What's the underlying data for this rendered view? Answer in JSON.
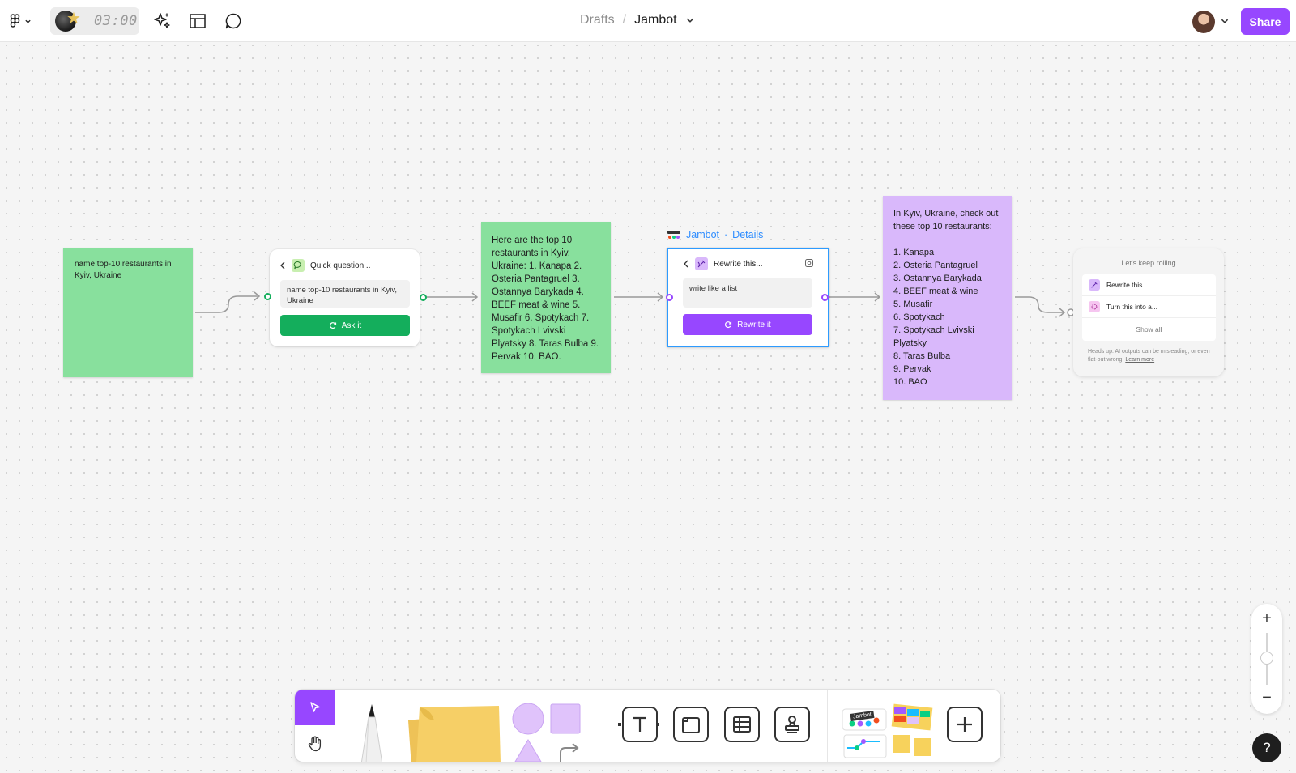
{
  "header": {
    "timer": "03:00",
    "breadcrumb_parent": "Drafts",
    "breadcrumb_separator": "/",
    "file_name": "Jambot",
    "share_label": "Share",
    "icons": [
      "figma-menu-icon",
      "timer-icon",
      "ai-sparkle-icon",
      "layout-icon",
      "comment-icon",
      "user-avatar",
      "chevron-down-icon"
    ]
  },
  "canvas": {
    "prompt_note": "name top-10 restaurants in Kyiv, Ukraine",
    "quick_card": {
      "title": "Quick question...",
      "input_value": "name top-10 restaurants in Kyiv, Ukraine",
      "button": "Ask it"
    },
    "answer_note": "Here are the top 10 restaurants in Kyiv, Ukraine: 1. Kanapa 2. Osteria Pantagruel 3. Ostannya Barykada 4. BEEF meat & wine 5. Musafir 6. Spotykach 7. Spotykach Lvivski Plyatsky 8. Taras Bulba 9. Pervak 10. BAO.",
    "jambot_label": {
      "name": "Jambot",
      "separator": "·",
      "details": "Details"
    },
    "rewrite_card": {
      "title": "Rewrite this...",
      "input_value": "write like a list",
      "button": "Rewrite it"
    },
    "list_note": {
      "intro": "In Kyiv, Ukraine, check out these top 10 restaurants:",
      "items": [
        "1. Kanapa",
        "2. Osteria Pantagruel",
        "3. Ostannya Barykada",
        "4. BEEF meat & wine",
        "5. Musafir",
        "6. Spotykach",
        "7. Spotykach Lvivski Plyatsky",
        "8. Taras Bulba",
        "9. Pervak",
        "10. BAO"
      ]
    },
    "next_card": {
      "title": "Let's keep rolling",
      "options": [
        "Rewrite this...",
        "Turn this into a..."
      ],
      "show_all": "Show all",
      "footer": "Heads up: AI outputs can be misleading, or even flat-out wrong.",
      "learn_more": "Learn more"
    },
    "colors": {
      "green_sticky": "#88e09d",
      "purple_sticky": "#d9b8fb",
      "accent_purple": "#9747ff",
      "ask_green": "#14ae5c",
      "selection_blue": "#2d9bff"
    }
  },
  "toolbar": {
    "tools": [
      "select",
      "hand",
      "marker",
      "sticky-note",
      "shapes",
      "connector",
      "text",
      "section",
      "table",
      "stamp",
      "jambot-widgets",
      "more"
    ],
    "jambot_tag": "Jambot",
    "plus": "+"
  },
  "zoom": {
    "plus": "+",
    "minus": "−"
  },
  "help": "?"
}
